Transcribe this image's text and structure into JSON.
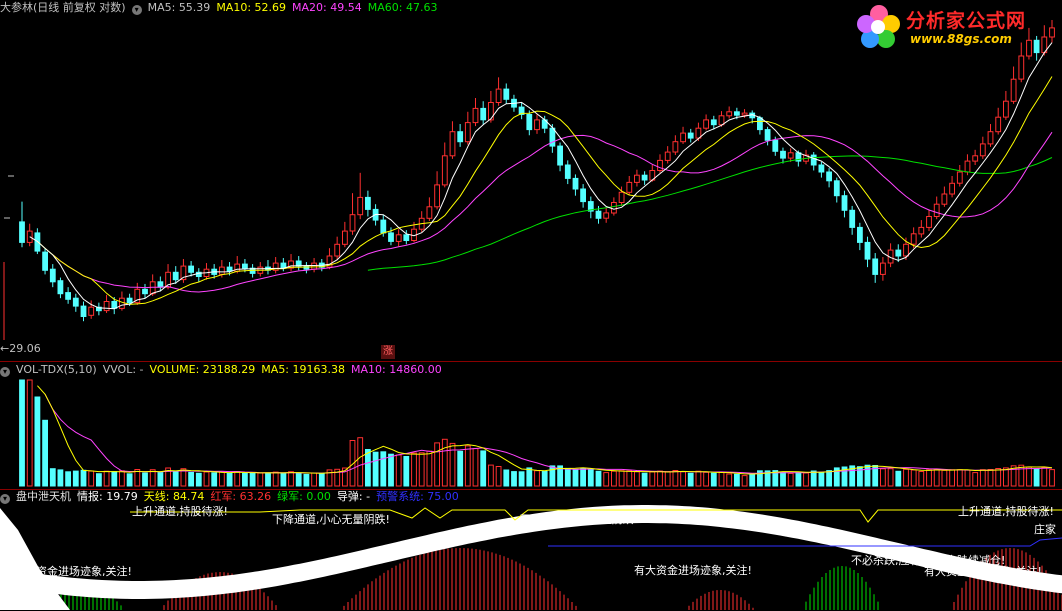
{
  "price_panel": {
    "title": "大参林(日线 前复权 对数)",
    "ma5": {
      "label": "MA5:",
      "value": "55.39",
      "color": "#ffffff"
    },
    "ma10": {
      "label": "MA10:",
      "value": "52.69",
      "color": "#ffff00"
    },
    "ma20": {
      "label": "MA20:",
      "value": "49.54",
      "color": "#ff44ff"
    },
    "ma60": {
      "label": "MA60:",
      "value": "47.63",
      "color": "#00e000"
    },
    "low_price": "29.06",
    "zhang_badge": "涨"
  },
  "logo": {
    "name": "分析家公式网",
    "url": "www.88gs.com"
  },
  "vol_panel": {
    "title": "VOL-TDX(5,10)",
    "vvol": "VVOL: -",
    "volume": {
      "label": "VOLUME:",
      "value": "23188.29",
      "color": "#ffff00"
    },
    "ma5": {
      "label": "MA5:",
      "value": "19163.38",
      "color": "#ffff00"
    },
    "ma10": {
      "label": "MA10:",
      "value": "14860.00",
      "color": "#ff44ff"
    }
  },
  "ind_panel": {
    "title": "盘中泄天机",
    "qingbao": {
      "label": "情报:",
      "value": "19.79",
      "color": "#ffffff"
    },
    "tianxian": {
      "label": "天线:",
      "value": "84.74",
      "color": "#ffff00"
    },
    "hongjun": {
      "label": "红军:",
      "value": "63.26",
      "color": "#ff3030"
    },
    "lvjun": {
      "label": "绿军:",
      "value": "0.00",
      "color": "#00e000"
    },
    "daodan": {
      "label": "导弹:",
      "value": "-",
      "color": "#ffffff"
    },
    "yujing": {
      "label": "预警系统:",
      "value": "75.00",
      "color": "#3030ff"
    },
    "annotations": [
      "上升通道,持股待涨!",
      "下降通道,小心无量阴跌!",
      "下降通道,小心无量阴跌!",
      "有大资金进场迹象,关注!",
      "有大资金进场迹象,关注!",
      "有大资金进场迹象,关注!",
      "不必杀跌,应有小反弹,陆续减仓!",
      "上升通道,持股待涨!",
      "庄家"
    ]
  },
  "chart_data": {
    "type": "candlestick",
    "ylim": [
      29.06,
      70
    ],
    "y_scale": "log",
    "candles": [
      [
        40.2,
        38.0,
        42.5,
        37.5
      ],
      [
        38.0,
        39.2,
        40.0,
        37.6
      ],
      [
        39.0,
        37.1,
        39.5,
        36.8
      ],
      [
        37.0,
        35.2,
        37.4,
        34.8
      ],
      [
        35.3,
        34.1,
        35.8,
        33.6
      ],
      [
        34.2,
        33.0,
        34.5,
        32.6
      ],
      [
        33.1,
        32.5,
        33.6,
        32.1
      ],
      [
        32.6,
        31.9,
        33.0,
        31.4
      ],
      [
        31.9,
        31.0,
        32.3,
        30.6
      ],
      [
        31.1,
        31.8,
        32.4,
        30.8
      ],
      [
        31.8,
        31.5,
        32.2,
        31.1
      ],
      [
        31.5,
        32.3,
        32.9,
        31.3
      ],
      [
        32.3,
        31.7,
        32.7,
        31.2
      ],
      [
        31.7,
        32.6,
        33.2,
        31.5
      ],
      [
        32.6,
        32.2,
        33.0,
        31.9
      ],
      [
        32.2,
        33.4,
        34.0,
        32.0
      ],
      [
        33.4,
        33.0,
        33.9,
        32.6
      ],
      [
        33.0,
        34.1,
        34.8,
        32.8
      ],
      [
        34.1,
        33.6,
        34.6,
        33.2
      ],
      [
        33.6,
        35.0,
        35.8,
        33.4
      ],
      [
        35.0,
        34.3,
        35.6,
        33.9
      ],
      [
        34.3,
        35.6,
        36.3,
        34.0
      ],
      [
        35.6,
        35.0,
        36.1,
        34.6
      ],
      [
        35.0,
        34.6,
        35.4,
        34.1
      ],
      [
        34.6,
        35.3,
        35.9,
        34.3
      ],
      [
        35.3,
        34.8,
        35.8,
        34.4
      ],
      [
        34.8,
        35.5,
        36.2,
        34.5
      ],
      [
        35.5,
        35.1,
        36.0,
        34.7
      ],
      [
        35.1,
        35.8,
        36.6,
        34.9
      ],
      [
        35.8,
        35.4,
        36.3,
        35.0
      ],
      [
        35.4,
        34.9,
        35.8,
        34.5
      ],
      [
        34.9,
        35.5,
        36.0,
        34.6
      ],
      [
        35.5,
        35.2,
        36.2,
        34.8
      ],
      [
        35.2,
        35.9,
        36.5,
        34.9
      ],
      [
        35.9,
        35.4,
        36.4,
        35.1
      ],
      [
        35.4,
        36.1,
        36.8,
        35.1
      ],
      [
        36.1,
        35.6,
        36.6,
        35.2
      ],
      [
        35.6,
        35.3,
        36.0,
        34.9
      ],
      [
        35.3,
        35.9,
        36.4,
        35.0
      ],
      [
        35.9,
        35.5,
        36.3,
        35.1
      ],
      [
        35.5,
        36.6,
        37.4,
        35.3
      ],
      [
        36.6,
        37.8,
        38.6,
        36.3
      ],
      [
        37.8,
        39.2,
        40.2,
        37.5
      ],
      [
        39.2,
        41.0,
        43.5,
        38.8
      ],
      [
        41.0,
        43.0,
        46.0,
        40.5
      ],
      [
        43.0,
        41.6,
        43.8,
        40.8
      ],
      [
        41.6,
        40.4,
        42.2,
        39.8
      ],
      [
        40.4,
        39.0,
        41.0,
        38.6
      ],
      [
        39.0,
        38.1,
        39.6,
        37.7
      ],
      [
        38.1,
        38.8,
        39.4,
        37.6
      ],
      [
        38.8,
        38.2,
        39.3,
        37.8
      ],
      [
        38.2,
        39.4,
        40.2,
        38.0
      ],
      [
        39.4,
        40.6,
        41.4,
        39.1
      ],
      [
        40.6,
        41.9,
        43.0,
        40.3
      ],
      [
        41.9,
        44.5,
        46.2,
        41.6
      ],
      [
        44.5,
        48.2,
        50.0,
        44.2
      ],
      [
        48.2,
        51.5,
        53.0,
        47.8
      ],
      [
        51.5,
        50.1,
        52.6,
        49.4
      ],
      [
        50.1,
        52.8,
        54.4,
        49.7
      ],
      [
        52.8,
        54.9,
        56.5,
        52.3
      ],
      [
        54.9,
        53.2,
        56.0,
        52.5
      ],
      [
        53.2,
        55.8,
        57.6,
        52.8
      ],
      [
        55.8,
        57.9,
        59.8,
        55.3
      ],
      [
        57.9,
        56.3,
        58.8,
        55.6
      ],
      [
        56.3,
        55.1,
        57.0,
        54.4
      ],
      [
        55.1,
        54.0,
        55.8,
        53.3
      ],
      [
        54.0,
        51.8,
        54.6,
        51.0
      ],
      [
        51.8,
        53.2,
        54.0,
        51.2
      ],
      [
        53.2,
        52.0,
        53.8,
        51.3
      ],
      [
        52.0,
        49.5,
        52.6,
        48.6
      ],
      [
        49.5,
        47.0,
        50.0,
        46.2
      ],
      [
        47.0,
        45.3,
        47.6,
        44.6
      ],
      [
        45.3,
        44.0,
        45.8,
        43.2
      ],
      [
        44.0,
        42.5,
        44.6,
        41.8
      ],
      [
        42.5,
        41.4,
        43.1,
        40.6
      ],
      [
        41.4,
        40.6,
        42.0,
        40.0
      ],
      [
        40.6,
        41.2,
        41.8,
        40.1
      ],
      [
        41.2,
        42.4,
        43.0,
        40.9
      ],
      [
        42.4,
        43.6,
        44.3,
        42.0
      ],
      [
        43.6,
        44.8,
        45.6,
        43.3
      ],
      [
        44.8,
        45.7,
        46.4,
        44.3
      ],
      [
        45.7,
        45.1,
        46.2,
        44.5
      ],
      [
        45.1,
        46.3,
        47.0,
        44.9
      ],
      [
        46.3,
        47.6,
        48.4,
        46.0
      ],
      [
        47.6,
        48.7,
        49.5,
        47.2
      ],
      [
        48.7,
        50.1,
        51.0,
        48.3
      ],
      [
        50.1,
        51.3,
        52.2,
        49.8
      ],
      [
        51.3,
        50.6,
        51.9,
        50.0
      ],
      [
        50.6,
        52.0,
        52.8,
        50.2
      ],
      [
        52.0,
        53.2,
        54.0,
        51.7
      ],
      [
        53.2,
        52.5,
        53.8,
        51.8
      ],
      [
        52.5,
        53.8,
        54.5,
        52.2
      ],
      [
        53.8,
        54.4,
        55.2,
        53.4
      ],
      [
        54.4,
        53.9,
        55.0,
        53.3
      ],
      [
        53.9,
        54.2,
        54.8,
        53.5
      ],
      [
        54.2,
        53.5,
        54.6,
        52.7
      ],
      [
        53.5,
        51.8,
        53.8,
        51.1
      ],
      [
        51.8,
        50.3,
        52.2,
        49.6
      ],
      [
        50.3,
        48.8,
        50.8,
        48.2
      ],
      [
        48.8,
        47.9,
        49.3,
        47.2
      ],
      [
        47.9,
        48.6,
        49.2,
        47.4
      ],
      [
        48.6,
        47.5,
        48.9,
        46.8
      ],
      [
        47.5,
        48.3,
        49.0,
        47.1
      ],
      [
        48.3,
        47.0,
        48.7,
        46.3
      ],
      [
        47.0,
        46.1,
        47.4,
        45.4
      ],
      [
        46.1,
        45.0,
        46.6,
        44.2
      ],
      [
        45.0,
        43.2,
        45.4,
        42.4
      ],
      [
        43.2,
        41.5,
        43.8,
        40.7
      ],
      [
        41.5,
        39.6,
        42.0,
        38.8
      ],
      [
        39.6,
        38.0,
        40.1,
        37.2
      ],
      [
        38.0,
        36.3,
        38.6,
        35.5
      ],
      [
        36.3,
        34.8,
        36.9,
        34.0
      ],
      [
        34.8,
        35.9,
        36.5,
        34.2
      ],
      [
        35.9,
        37.2,
        37.9,
        35.5
      ],
      [
        37.2,
        36.6,
        37.8,
        36.0
      ],
      [
        36.6,
        37.8,
        38.5,
        36.2
      ],
      [
        37.8,
        38.9,
        39.6,
        37.4
      ],
      [
        38.9,
        39.6,
        40.4,
        38.5
      ],
      [
        39.6,
        40.8,
        41.6,
        39.2
      ],
      [
        40.8,
        42.2,
        43.1,
        40.5
      ],
      [
        42.2,
        43.4,
        44.3,
        41.9
      ],
      [
        43.4,
        44.7,
        45.6,
        43.0
      ],
      [
        44.7,
        46.1,
        47.0,
        44.3
      ],
      [
        46.1,
        47.5,
        48.4,
        45.7
      ],
      [
        47.5,
        48.2,
        49.0,
        47.0
      ],
      [
        48.2,
        49.8,
        50.8,
        47.8
      ],
      [
        49.8,
        51.5,
        52.6,
        49.4
      ],
      [
        51.5,
        53.6,
        55.0,
        51.1
      ],
      [
        53.6,
        56.0,
        57.6,
        53.2
      ],
      [
        56.0,
        59.5,
        61.6,
        55.6
      ],
      [
        59.5,
        63.4,
        65.8,
        59.0
      ],
      [
        63.4,
        66.2,
        68.5,
        62.8
      ],
      [
        66.2,
        64.0,
        67.0,
        62.6
      ],
      [
        64.0,
        66.8,
        69.0,
        63.5
      ],
      [
        66.8,
        68.5,
        70.0,
        65.8
      ]
    ]
  }
}
